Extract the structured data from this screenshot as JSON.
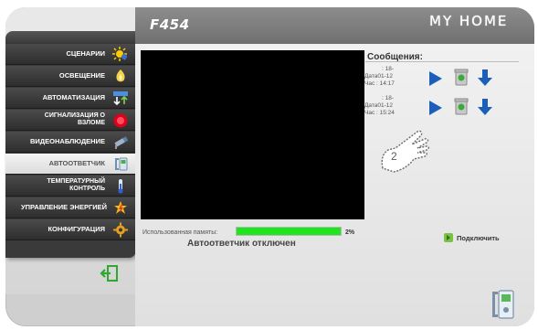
{
  "header": {
    "model": "F454",
    "brand": "MY HOME"
  },
  "menu": {
    "items": [
      {
        "label": "СЦЕНАРИИ",
        "icon": "sun-icon"
      },
      {
        "label": "ОСВЕЩЕНИЕ",
        "icon": "bulb-icon"
      },
      {
        "label": "АВТОМАТИЗАЦИЯ",
        "icon": "arrows-updown-icon"
      },
      {
        "label": "СИГНАЛИЗАЦИЯ О ВЗЛОМЕ",
        "icon": "alarm-icon"
      },
      {
        "label": "ВИДЕОНАБЛЮДЕНИЕ",
        "icon": "camera-icon"
      },
      {
        "label": "АВТООТВЕТЧИК",
        "icon": "answering-machine-icon",
        "active": true
      },
      {
        "label": "ТЕМПЕРАТУРНЫЙ КОНТРОЛЬ",
        "icon": "thermometer-icon"
      },
      {
        "label": "УПРАВЛЕНИЕ ЭНЕРГИЕЙ",
        "icon": "energy-icon"
      },
      {
        "label": "КОНФИГУРАЦИЯ",
        "icon": "gear-icon"
      }
    ]
  },
  "memory": {
    "label": "Использованная памяты:",
    "percent_text": "2%",
    "fill_percent": 100
  },
  "status": "Автоответчик отключен",
  "messages": {
    "title": "Сообщения:",
    "list": [
      {
        "line1": ": 18-",
        "line2": "Дата01-12",
        "line3": "Час : 14:17"
      },
      {
        "line1": ": 18-",
        "line2": "Дата01-12",
        "line3": "Час : 15:24"
      }
    ]
  },
  "connect": {
    "label": "Подключить"
  },
  "callout": {
    "number": "2"
  },
  "colors": {
    "accent_green": "#1ee51e",
    "play_blue": "#1d5fb8",
    "menu_dark": "#3a3a3a"
  }
}
